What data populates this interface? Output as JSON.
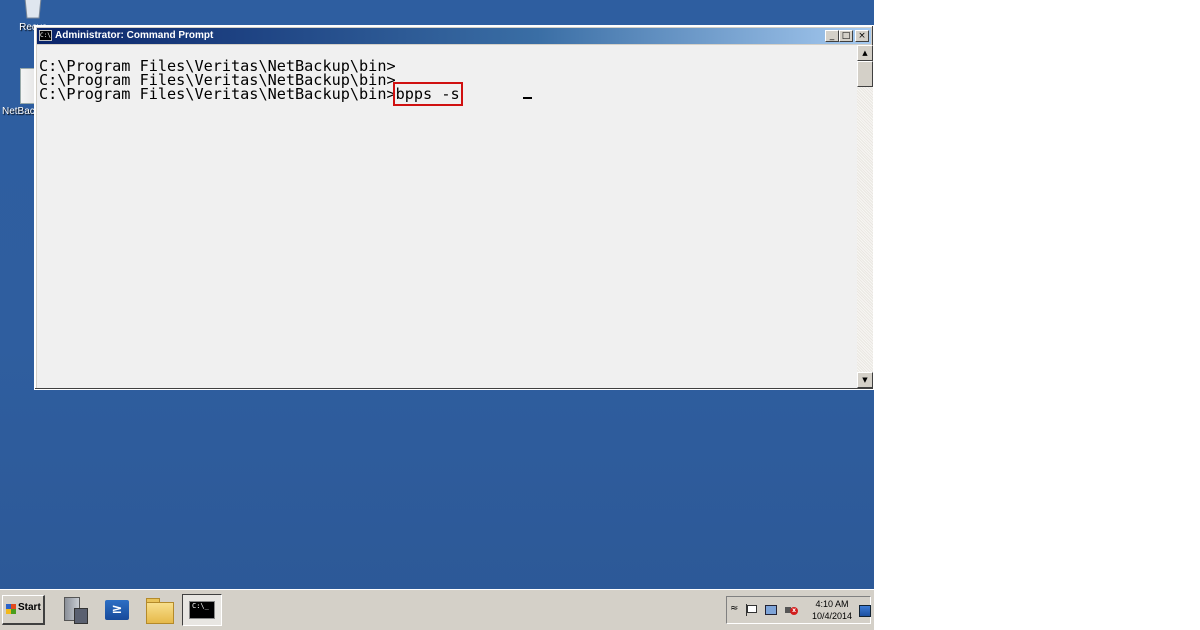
{
  "desktop": {
    "icons": [
      {
        "label": "Recyc",
        "icon": "recycle-bin-icon"
      },
      {
        "label": "NetBac",
        "icon": "netbackup-icon"
      }
    ]
  },
  "window": {
    "title": "Administrator: Command Prompt",
    "icon_glyph": "C:\\",
    "buttons": {
      "minimize": "_",
      "maximize": "□",
      "close": "×"
    }
  },
  "console": {
    "lines": [
      "C:\\Program Files\\Veritas\\NetBackup\\bin>",
      "C:\\Program Files\\Veritas\\NetBackup\\bin>",
      "C:\\Program Files\\Veritas\\NetBackup\\bin>"
    ],
    "command": "bpps -s",
    "highlight_color": "#d01010"
  },
  "scrollbar": {
    "up_glyph": "▲",
    "down_glyph": "▼"
  },
  "taskbar": {
    "start_label": "Start",
    "pinned": [
      "server-manager-icon",
      "powershell-icon",
      "explorer-folder-icon",
      "command-prompt-icon"
    ],
    "powershell_glyph": "≥",
    "cmd_glyph": "C:\\_"
  },
  "tray": {
    "chevron": "≈",
    "time": "4:10 AM",
    "date": "10/4/2014",
    "volume_mark": "x"
  }
}
